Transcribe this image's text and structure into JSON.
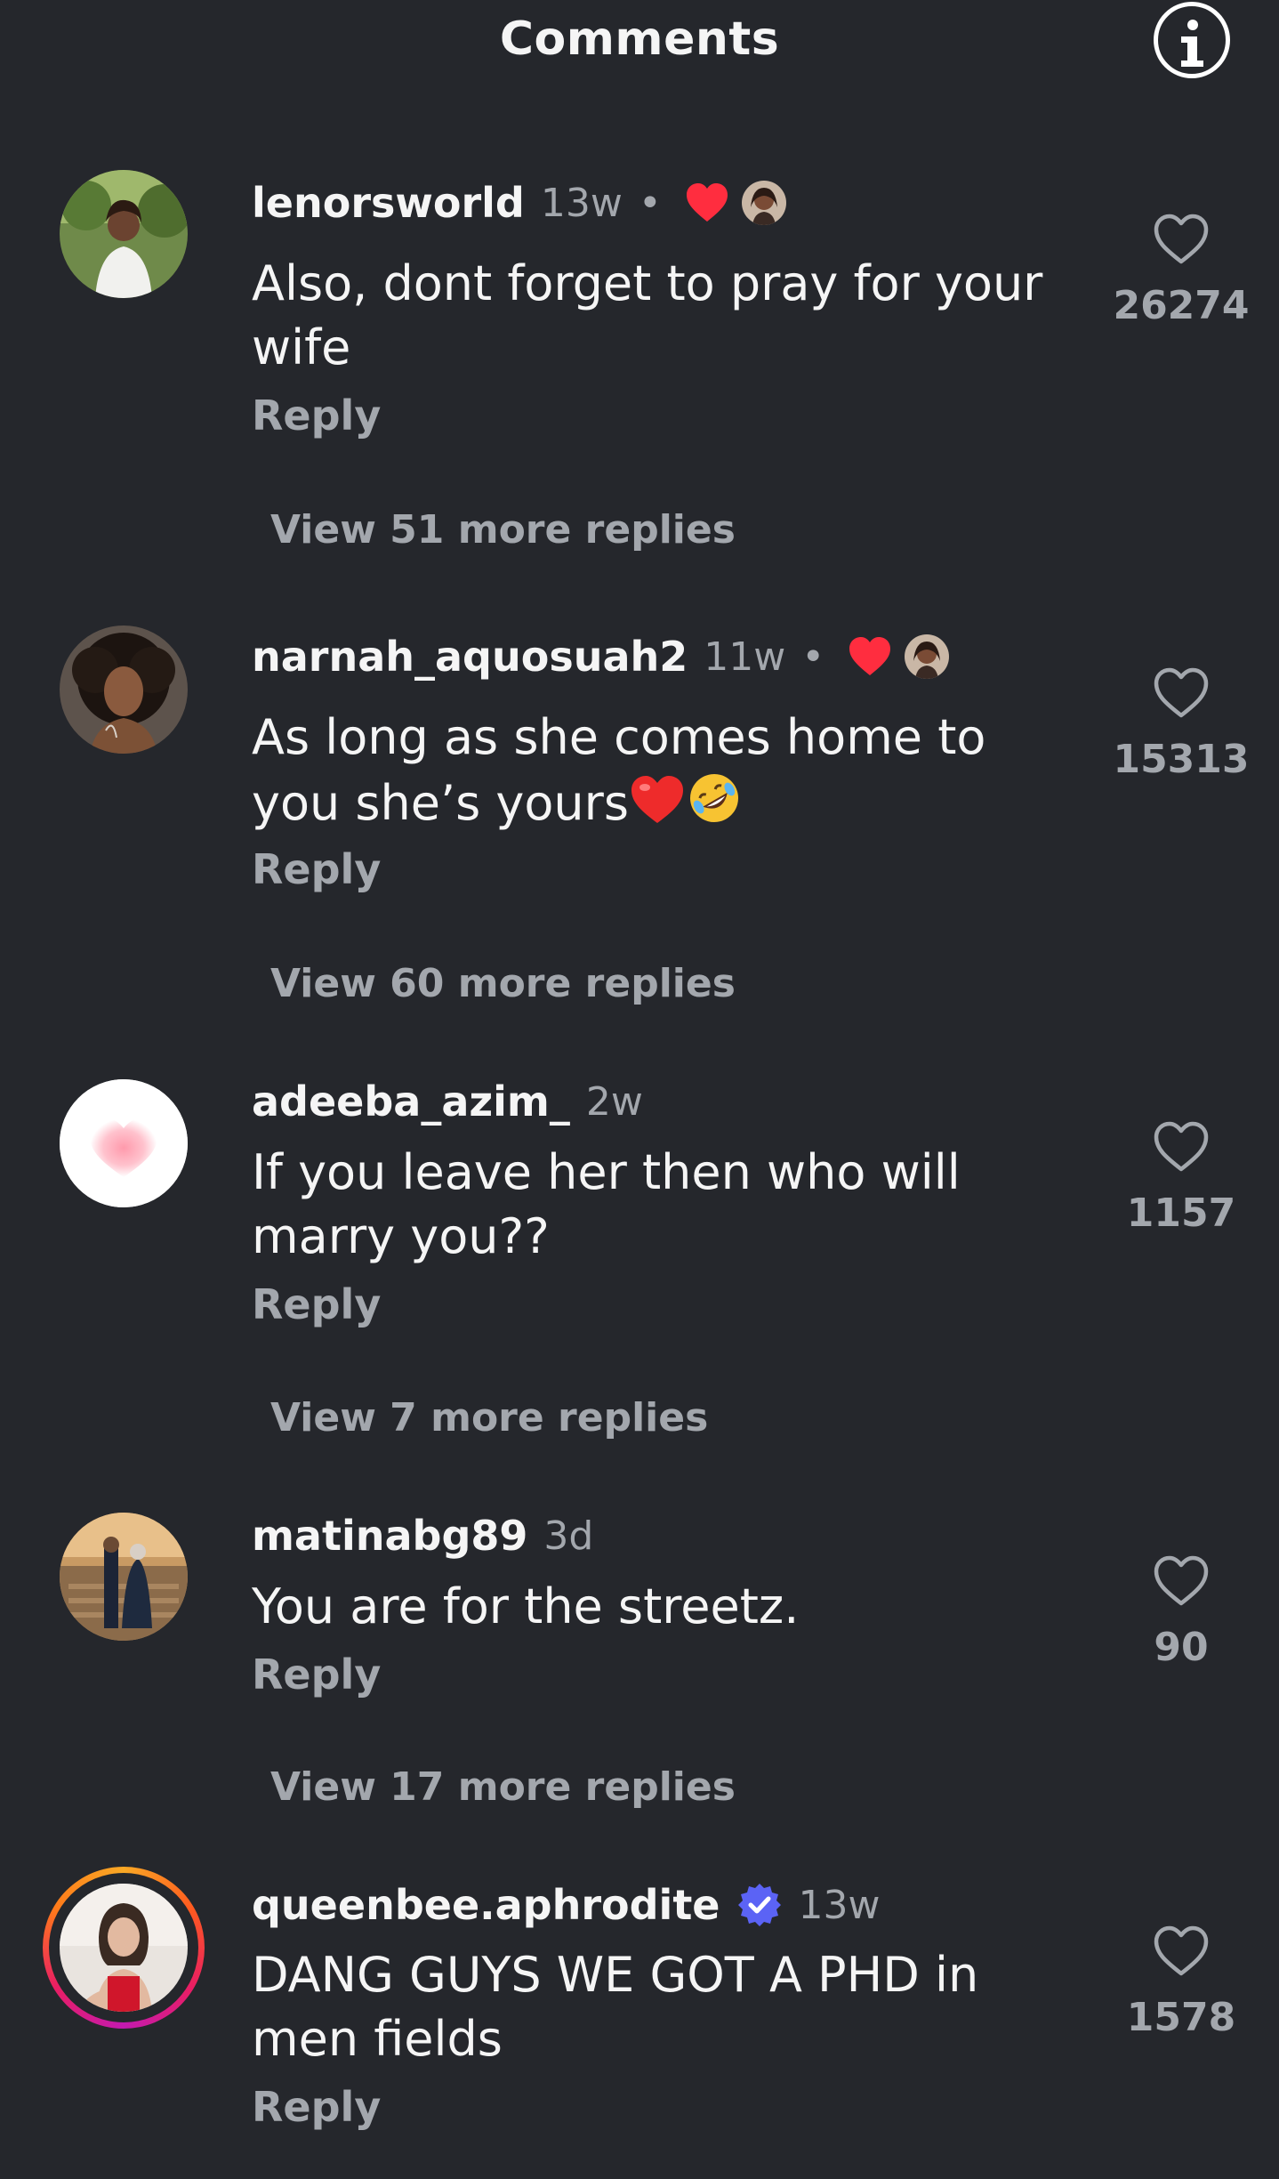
{
  "header": {
    "title": "Comments",
    "info_icon": "info-icon"
  },
  "comments": [
    {
      "username": "lenorsworld",
      "time": "13w",
      "dot": "•",
      "author_liked": true,
      "text": "Also, dont forget to pray for your wife",
      "reply_label": "Reply",
      "likes": "26274",
      "view_replies": "View 51 more replies"
    },
    {
      "username": "narnah_aquosuah2",
      "time": "11w",
      "dot": "•",
      "author_liked": true,
      "text": "As long as she comes home to you she’s yours",
      "text_emojis": [
        "heart-emoji",
        "rofl-emoji"
      ],
      "reply_label": "Reply",
      "likes": "15313",
      "view_replies": "View 60 more replies"
    },
    {
      "username": "adeeba_azim_",
      "time": "2w",
      "text": "If you leave her then who will marry you??",
      "reply_label": "Reply",
      "likes": "1157",
      "view_replies": "View 7 more replies"
    },
    {
      "username": "matinabg89",
      "time": "3d",
      "text": "You are for the streetz.",
      "reply_label": "Reply",
      "likes": "90",
      "view_replies": "View 17 more replies"
    },
    {
      "username": "queenbee.aphrodite",
      "verified": true,
      "time": "13w",
      "text": "DANG GUYS WE GOT A PHD in men fields",
      "reply_label": "Reply",
      "likes": "1578"
    }
  ],
  "colors": {
    "background": "#25272c",
    "primary_text": "#f5f5f5",
    "secondary_text": "#a3a7ad",
    "heart_red": "#ff2d3f",
    "verified_blue": "#5b63f5"
  }
}
